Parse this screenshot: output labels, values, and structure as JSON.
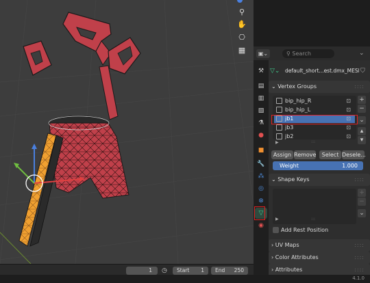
{
  "header": {
    "search_placeholder": "Search",
    "breadcrumb_object": "default_short...est.dmx_MESH"
  },
  "vertex_groups": {
    "title": "Vertex Groups",
    "items": [
      {
        "label": "bip_hip_R",
        "selected": false
      },
      {
        "label": "bip_hip_L",
        "selected": false
      },
      {
        "label": "jb1",
        "selected": true
      },
      {
        "label": "jb3",
        "selected": false
      },
      {
        "label": "jb2",
        "selected": false
      }
    ],
    "assign_label": "Assign",
    "remove_label": "Remove",
    "select_label": "Select",
    "deselect_label": "Desele...",
    "weight_label": "Weight",
    "weight_value": "1.000",
    "weight_fraction": 1.0
  },
  "shape_keys": {
    "title": "Shape Keys",
    "add_rest_label": "Add Rest Position"
  },
  "sections": {
    "uv_maps": "UV Maps",
    "color_attributes": "Color Attributes",
    "attributes": "Attributes"
  },
  "timeline": {
    "current_frame": "1",
    "start_label": "Start",
    "start_value": "1",
    "end_label": "End",
    "end_value": "250"
  },
  "status": {
    "version": "4.1.0"
  },
  "colors": {
    "accent": "#4772b3",
    "mesh_red": "#c0404a",
    "selected_orange": "#f0a030",
    "highlight": "#e02020"
  },
  "icons": {
    "viewport_tools": [
      "zoom-icon",
      "hand-icon",
      "camera-icon",
      "grid-icon"
    ],
    "property_tabs": [
      "tool-icon",
      "render-icon",
      "output-icon",
      "view-layer-icon",
      "scene-icon",
      "world-icon",
      "object-icon",
      "modifier-icon",
      "particles-icon",
      "physics-icon",
      "constraints-icon",
      "data-icon",
      "material-icon"
    ]
  }
}
